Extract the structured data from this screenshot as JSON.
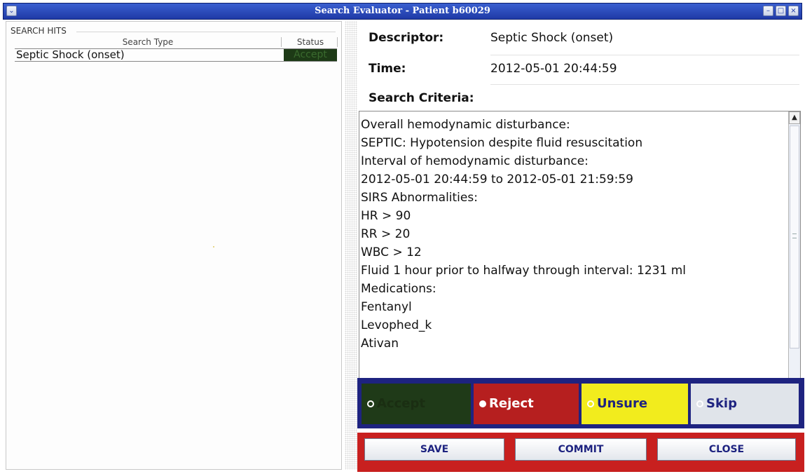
{
  "window": {
    "title": "Search Evaluator - Patient b60029"
  },
  "search_hits": {
    "group_label": "SEARCH HITS",
    "columns": [
      "Search Type",
      "Status"
    ],
    "rows": [
      {
        "search_type": "Septic Shock (onset)",
        "status": "Accept"
      }
    ]
  },
  "details": {
    "descriptor_label": "Descriptor:",
    "descriptor_value": "Septic Shock (onset)",
    "time_label": "Time:",
    "time_value": "2012-05-01 20:44:59",
    "criteria_label": "Search Criteria:",
    "criteria_lines": [
      "Overall hemodynamic disturbance:",
      "SEPTIC: Hypotension despite fluid resuscitation",
      "Interval of hemodynamic disturbance:",
      "2012-05-01 20:44:59 to 2012-05-01 21:59:59",
      "SIRS Abnormalities:",
      "HR > 90",
      "RR > 20",
      "WBC > 12",
      "Fluid 1 hour prior to halfway through interval: 1231 ml",
      "Medications:",
      "Fentanyl",
      "Levophed_k",
      "Ativan"
    ]
  },
  "status_options": {
    "accept": "Accept",
    "reject": "Reject",
    "unsure": "Unsure",
    "skip": "Skip",
    "selected": "none"
  },
  "actions": {
    "save": "SAVE",
    "commit": "COMMIT",
    "close": "CLOSE"
  },
  "colors": {
    "accept": "#1f3a18",
    "reject": "#b61f1f",
    "unsure": "#f2ec1d",
    "skip": "#e0e4ea",
    "status_strip": "#1e2380",
    "button_strip": "#c8201f",
    "titlebar": "#2a48bf"
  }
}
